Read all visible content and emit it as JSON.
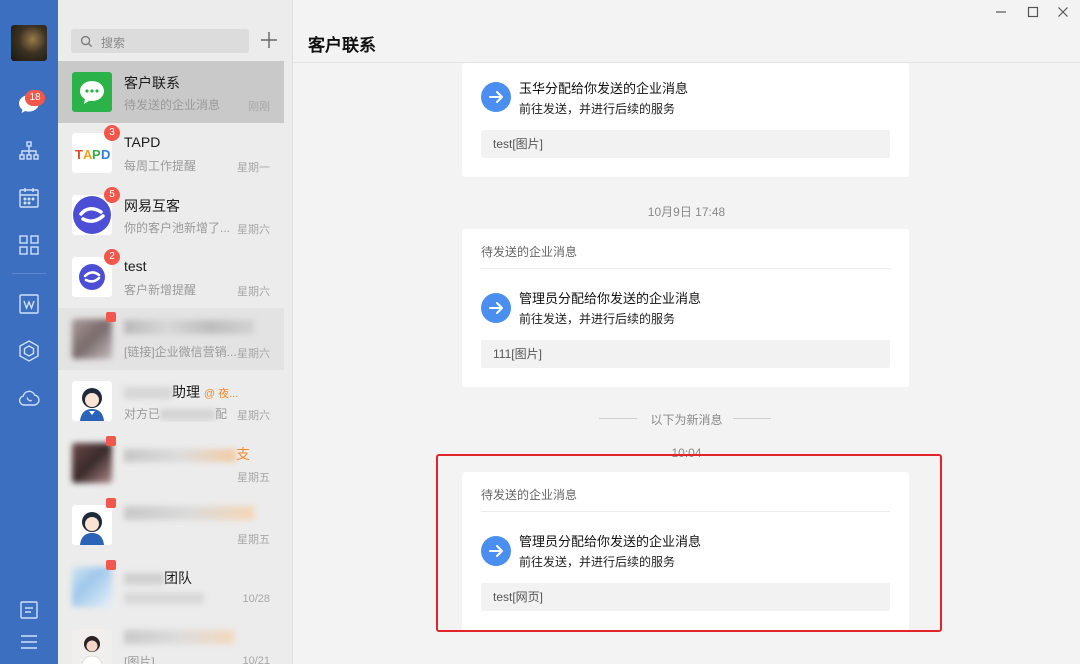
{
  "rail": {
    "chat_badge": "18",
    "icons": [
      "chat-icon",
      "org-icon",
      "calendar-icon",
      "apps-icon",
      "doc-icon",
      "workspace-icon",
      "cloud-phone-icon",
      "notes-icon",
      "menu-icon"
    ]
  },
  "search": {
    "placeholder": "搜索"
  },
  "conversations": [
    {
      "name": "客户联系",
      "preview": "待发送的企业消息",
      "time": "刚刚",
      "badge": ""
    },
    {
      "name": "TAPD",
      "preview": "每周工作提醒",
      "time": "星期一",
      "badge": "3"
    },
    {
      "name": "网易互客",
      "preview": "你的客户池新增了...",
      "time": "星期六",
      "badge": "5"
    },
    {
      "name": "test",
      "preview": "客户新增提醒",
      "time": "星期六",
      "badge": "2"
    },
    {
      "name": "",
      "preview": "[链接]企业微信营销...",
      "time": "星期六",
      "badge": ""
    },
    {
      "name": "助理",
      "mention": "@ 夜...",
      "preview": "对方已",
      "preview_tail": "配",
      "time": "星期六",
      "badge": ""
    },
    {
      "name": "",
      "tail": "支",
      "preview": "",
      "time": "星期五",
      "badge": ""
    },
    {
      "name": "",
      "preview": "",
      "time": "星期五",
      "badge": ""
    },
    {
      "name": "团队",
      "preview": "",
      "time": "10/28",
      "badge": ""
    },
    {
      "name": "",
      "preview": "[图片]",
      "time": "10/21",
      "badge": ""
    }
  ],
  "main": {
    "title": "客户联系",
    "cards": [
      {
        "title": "",
        "line1": "玉华分配给你发送的企业消息",
        "line2": "前往发送，并进行后续的服务",
        "note": "test[图片]"
      },
      {
        "title": "待发送的企业消息",
        "line1": "管理员分配给你发送的企业消息",
        "line2": "前往发送，并进行后续的服务",
        "note": "111[图片]"
      },
      {
        "title": "待发送的企业消息",
        "line1": "管理员分配给你发送的企业消息",
        "line2": "前往发送，并进行后续的服务",
        "note": "test[网页]"
      }
    ],
    "timestamp1": "10月9日 17:48",
    "new_divider": "以下为新消息",
    "timestamp2": "10:04"
  },
  "colors": {
    "rail": "#3d6fc1",
    "accent": "#4a8ef0",
    "badge": "#f2574b",
    "highlight": "#e3232a"
  }
}
